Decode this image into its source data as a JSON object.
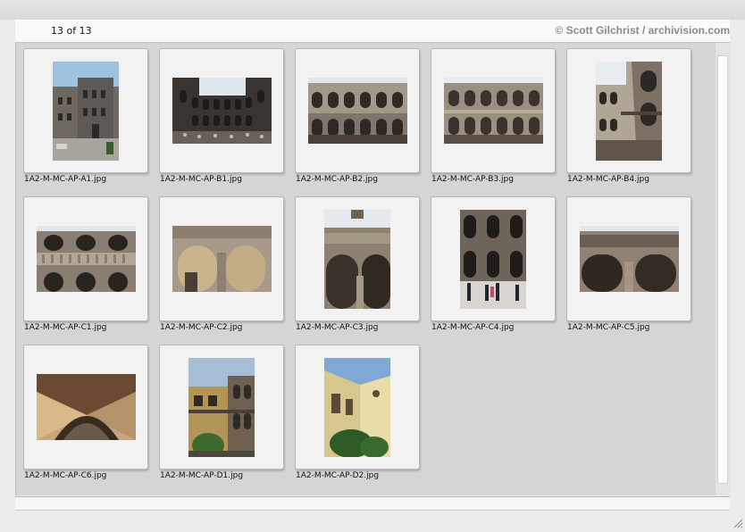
{
  "header": {
    "counter": "13 of 13",
    "credit": "© Scott Gilchrist / archivision.com"
  },
  "thumbnails": [
    {
      "filename": "1A2-M-MC-AP-A1.jpg",
      "subject": "palace-facade-photo"
    },
    {
      "filename": "1A2-M-MC-AP-B1.jpg",
      "subject": "courtyard-arcade-photo"
    },
    {
      "filename": "1A2-M-MC-AP-B2.jpg",
      "subject": "courtyard-arcade-photo"
    },
    {
      "filename": "1A2-M-MC-AP-B3.jpg",
      "subject": "courtyard-arcade-photo"
    },
    {
      "filename": "1A2-M-MC-AP-B4.jpg",
      "subject": "arcade-corridor-photo"
    },
    {
      "filename": "1A2-M-MC-AP-C1.jpg",
      "subject": "arcade-balustrade-photo"
    },
    {
      "filename": "1A2-M-MC-AP-C2.jpg",
      "subject": "stone-arches-photo"
    },
    {
      "filename": "1A2-M-MC-AP-C3.jpg",
      "subject": "arch-detail-photo"
    },
    {
      "filename": "1A2-M-MC-AP-C4.jpg",
      "subject": "courtyard-visitors-photo"
    },
    {
      "filename": "1A2-M-MC-AP-C5.jpg",
      "subject": "arcade-detail-photo"
    },
    {
      "filename": "1A2-M-MC-AP-C6.jpg",
      "subject": "vaulted-ceiling-photo"
    },
    {
      "filename": "1A2-M-MC-AP-D1.jpg",
      "subject": "courtyard-tree-photo"
    },
    {
      "filename": "1A2-M-MC-AP-D2.jpg",
      "subject": "yellow-wall-garden-photo"
    }
  ]
}
